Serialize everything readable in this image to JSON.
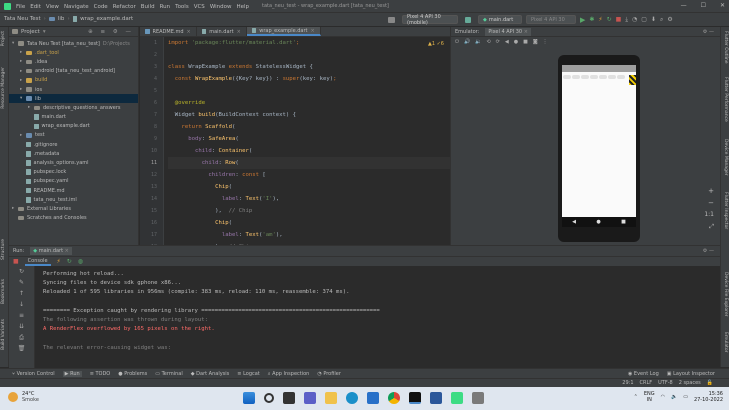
{
  "titlebar": {
    "menu": [
      "File",
      "Edit",
      "View",
      "Navigate",
      "Code",
      "Refactor",
      "Build",
      "Run",
      "Tools",
      "VCS",
      "Window",
      "Help"
    ],
    "title": "tata_neu_test - wrap_example.dart [tata_neu_test]"
  },
  "toolbar": {
    "breadcrumbs": [
      "Tata Neu Test",
      "lib",
      "wrap_example.dart"
    ],
    "device": "Pixel 4 API 30 (mobile)",
    "run_config": "main.dart",
    "emulator_device": "Pixel 4 API 30"
  },
  "project": {
    "header": "Project",
    "items": [
      {
        "label": "Tata Neu Test [tata_neu_test]",
        "extra": "D:\\Projects",
        "indent": 0,
        "kind": "folder",
        "caret": "v"
      },
      {
        "label": ".dart_tool",
        "indent": 1,
        "kind": "folder-or",
        "caret": ">"
      },
      {
        "label": ".idea",
        "indent": 1,
        "kind": "folder",
        "caret": ">"
      },
      {
        "label": "android [tata_neu_test_android]",
        "indent": 1,
        "kind": "folder",
        "caret": ">"
      },
      {
        "label": "build",
        "indent": 1,
        "kind": "folder-or",
        "caret": ">"
      },
      {
        "label": "ios",
        "indent": 1,
        "kind": "folder",
        "caret": ">"
      },
      {
        "label": "lib",
        "indent": 1,
        "kind": "folder-blue",
        "caret": "v",
        "selected": true
      },
      {
        "label": "descriptive_questions_answers",
        "indent": 2,
        "kind": "folder",
        "caret": ">"
      },
      {
        "label": "main.dart",
        "indent": 2,
        "kind": "file"
      },
      {
        "label": "wrap_example.dart",
        "indent": 2,
        "kind": "file"
      },
      {
        "label": "test",
        "indent": 1,
        "kind": "folder-blue",
        "caret": ">"
      },
      {
        "label": ".gitignore",
        "indent": 1,
        "kind": "file"
      },
      {
        "label": ".metadata",
        "indent": 1,
        "kind": "file"
      },
      {
        "label": "analysis_options.yaml",
        "indent": 1,
        "kind": "file"
      },
      {
        "label": "pubspec.lock",
        "indent": 1,
        "kind": "file"
      },
      {
        "label": "pubspec.yaml",
        "indent": 1,
        "kind": "file"
      },
      {
        "label": "README.md",
        "indent": 1,
        "kind": "file"
      },
      {
        "label": "tata_neu_test.iml",
        "indent": 1,
        "kind": "file"
      },
      {
        "label": "External Libraries",
        "indent": 0,
        "kind": "folder",
        "caret": ">"
      },
      {
        "label": "Scratches and Consoles",
        "indent": 0,
        "kind": "folder"
      }
    ]
  },
  "editor": {
    "tabs": [
      {
        "label": "README.md",
        "active": false
      },
      {
        "label": "main.dart",
        "active": false
      },
      {
        "label": "wrap_example.dart",
        "active": true
      }
    ],
    "warnings": "▲1 ✓6",
    "line_numbers": [
      "1",
      "2",
      "3",
      "4",
      "5",
      "6",
      "7",
      "8",
      "9",
      "10",
      "11",
      "12",
      "13",
      "14",
      "15",
      "16",
      "17",
      "18"
    ],
    "current_line_index": 10
  },
  "emulator": {
    "tab_label": "Emulator:",
    "device_tab": "Pixel 4 API 30",
    "nav": [
      "◀",
      "●",
      "■"
    ]
  },
  "run": {
    "header_label": "Run:",
    "config": "main.dart",
    "tab_console": "Console",
    "lines": [
      {
        "text": "Performing hot reload...",
        "style": "normal"
      },
      {
        "text": "Syncing files to device sdk gphone x86...",
        "style": "normal"
      },
      {
        "text": "Reloaded 1 of 595 libraries in 956ms (compile: 383 ms, reload: 110 ms, reassemble: 374 ms).",
        "style": "normal"
      },
      {
        "text": "",
        "style": "normal"
      },
      {
        "text": "======== Exception caught by rendering library =====================================================",
        "style": "normal"
      },
      {
        "text": "The following assertion was thrown during layout:",
        "style": "gray"
      },
      {
        "text": "A RenderFlex overflowed by 165 pixels on the right.",
        "style": "red"
      },
      {
        "text": "",
        "style": "normal"
      },
      {
        "text": "The relevant error-causing widget was:",
        "style": "gray"
      }
    ]
  },
  "bottom_tools": [
    "Version Control",
    "Run",
    "TODO",
    "Problems",
    "Terminal",
    "Dart Analysis",
    "Logcat",
    "App Inspection",
    "Profiler"
  ],
  "bottom_right_tools": [
    "Event Log",
    "Layout Inspector"
  ],
  "statusbar": {
    "position": "29:1",
    "line_sep": "CRLF",
    "encoding": "UTF-8",
    "indent": "2 spaces"
  },
  "side_labels": {
    "left": [
      "Project",
      "Resource Manager",
      "Structure",
      "Bookmarks",
      "Build Variants"
    ],
    "right": [
      "Flutter Outline",
      "Flutter Performance",
      "Device Manager",
      "Flutter Inspector",
      "Device File Explorer",
      "Emulator"
    ]
  },
  "taskbar": {
    "temperature": "24°C",
    "weather": "Smoke",
    "lang_1": "ENG",
    "lang_2": "IN",
    "time": "15:36",
    "date": "27-10-2022"
  }
}
